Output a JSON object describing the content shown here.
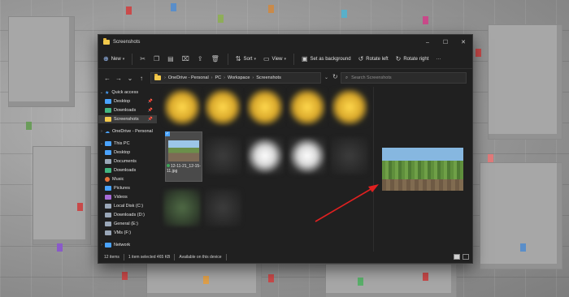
{
  "window": {
    "title": "Screenshots",
    "controls": {
      "minimize": "–",
      "maximize": "☐",
      "close": "✕"
    }
  },
  "toolbar": {
    "new_label": "New",
    "sort_label": "Sort",
    "view_label": "View",
    "set_background_label": "Set as background",
    "rotate_left_label": "Rotate left",
    "rotate_right_label": "Rotate right",
    "more_label": "···"
  },
  "nav": {
    "back": "←",
    "forward": "→",
    "dropdown": "⌄",
    "up": "↑"
  },
  "address": {
    "breadcrumbs": [
      "OneDrive - Personal",
      "PC",
      "Workspace",
      "Screenshots"
    ],
    "search_placeholder": "Search Screenshots"
  },
  "sidebar": {
    "items": [
      {
        "label": "Quick access",
        "icon": "star-icon",
        "color": "#4aa3ff"
      },
      {
        "label": "Desktop",
        "icon": "desktop-icon",
        "color": "#4aa3ff",
        "pinned": true
      },
      {
        "label": "Downloads",
        "icon": "download-icon",
        "color": "#43b581",
        "pinned": true
      },
      {
        "label": "Screenshots",
        "icon": "folder-icon",
        "color": "#f2c94c",
        "pinned": true,
        "selected": true
      },
      {
        "label": "OneDrive - Personal",
        "icon": "cloud-icon",
        "color": "#4aa3ff"
      },
      {
        "label": "This PC",
        "icon": "pc-icon",
        "color": "#4aa3ff"
      },
      {
        "label": "Desktop",
        "icon": "desktop-icon",
        "color": "#4aa3ff"
      },
      {
        "label": "Documents",
        "icon": "documents-icon",
        "color": "#9aa7b8"
      },
      {
        "label": "Downloads",
        "icon": "download-icon",
        "color": "#43b581"
      },
      {
        "label": "Music",
        "icon": "music-icon",
        "color": "#e8743b"
      },
      {
        "label": "Pictures",
        "icon": "pictures-icon",
        "color": "#4aa3ff"
      },
      {
        "label": "Videos",
        "icon": "videos-icon",
        "color": "#a66bd6"
      },
      {
        "label": "Local Disk (C:)",
        "icon": "drive-icon",
        "color": "#9aa7b8"
      },
      {
        "label": "Downloads (D:)",
        "icon": "drive-icon",
        "color": "#9aa7b8"
      },
      {
        "label": "General (E:)",
        "icon": "drive-icon",
        "color": "#9aa7b8"
      },
      {
        "label": "VMs (F:)",
        "icon": "drive-icon",
        "color": "#9aa7b8"
      },
      {
        "label": "Network",
        "icon": "network-icon",
        "color": "#4aa3ff"
      }
    ]
  },
  "files": {
    "selected_file_label": "12-11-21_12-15-11.jpg"
  },
  "status": {
    "items_count": "12 items",
    "selection": "1 item selected  465 KB",
    "availability": "Available on this device"
  },
  "colors": {
    "accent": "#4aa3ff",
    "annotation_arrow": "#e02020"
  }
}
